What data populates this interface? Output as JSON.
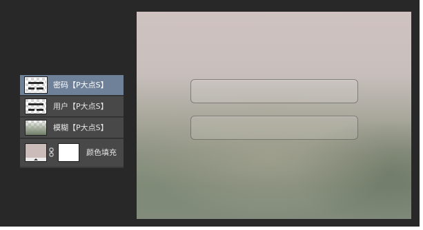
{
  "layers": [
    {
      "name": "密码【P大点S】",
      "selected": true,
      "thumb": "text-layer-thumb"
    },
    {
      "name": "用户【P大点S】",
      "selected": false,
      "thumb": "text-layer-thumb"
    },
    {
      "name": "模糊【P大点S】",
      "selected": false,
      "thumb": "blur-layer-thumb"
    },
    {
      "name": "颜色填充",
      "selected": false,
      "thumb": "fill-swatch",
      "fill_color": "#cbbcb9",
      "mask_color": "#ffffff"
    }
  ],
  "colors": {
    "app_background": "#282828",
    "panel_row": "#484848",
    "selected_row": "#6f8199"
  },
  "icons": [
    "smart-object-icon",
    "chain-link-icon"
  ]
}
